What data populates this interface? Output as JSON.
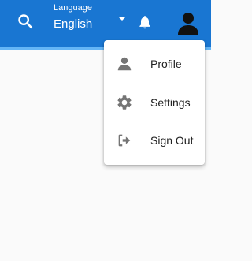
{
  "header": {
    "background_color": "#1976d2",
    "search_icon": "search-icon",
    "language": {
      "caption": "Language",
      "selected": "English"
    },
    "notifications_icon": "bell-icon",
    "account_icon": "account-avatar-icon"
  },
  "account_menu": {
    "items": [
      {
        "label": "Profile",
        "icon": "person-icon"
      },
      {
        "label": "Settings",
        "icon": "gear-icon"
      },
      {
        "label": "Sign Out",
        "icon": "sign-out-icon"
      }
    ]
  }
}
